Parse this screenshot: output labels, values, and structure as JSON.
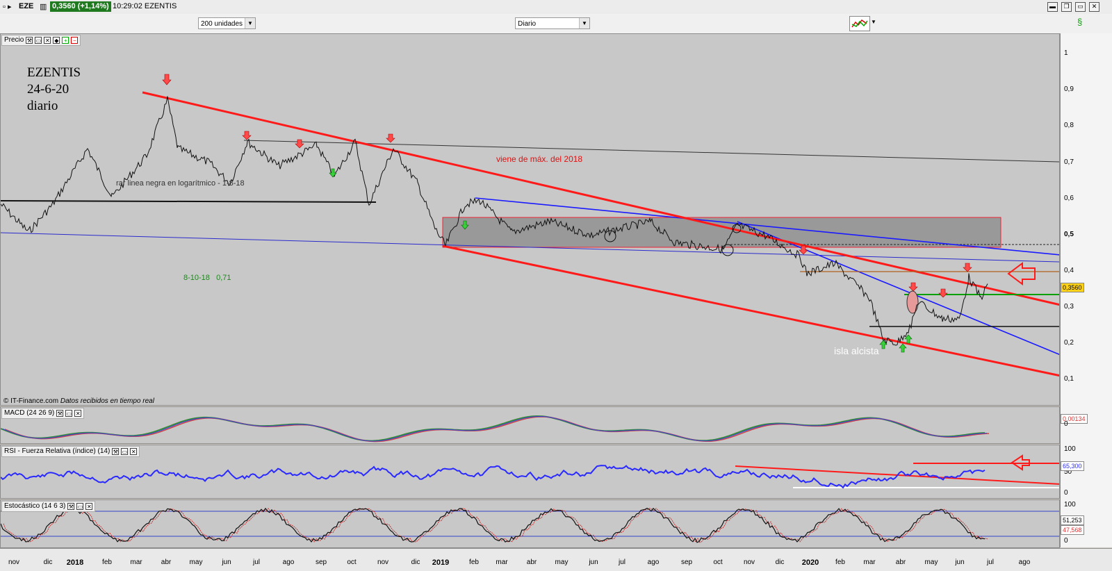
{
  "titlebar": {
    "symbol": "EZE",
    "price_badge": "0,3560 (+1,14%)",
    "time_name": "10:29:02 EZENTIS"
  },
  "toolbar": {
    "units_select": "200 unidades",
    "period_select": "Diario"
  },
  "price_panel": {
    "label": "Precio",
    "title_lines": [
      "EZENTIS",
      "24-6-20",
      "diario"
    ],
    "annotation_max_2018": "viene de máx. del 2018",
    "annotation_log": "rar linea negra en logarítmico - 1-8-18",
    "annotation_date": "8-10-18   0,71",
    "annotation_island": "isla alcista",
    "footer_source": "© IT-Finance.com",
    "footer_note": "Datos recibidos en tiempo real",
    "y_ticks": [
      "1",
      "0,9",
      "0,8",
      "0,7",
      "0,6",
      "0,5",
      "0,4",
      "0,3",
      "0,2",
      "0,1"
    ],
    "last_price": "0,3560"
  },
  "macd_panel": {
    "label": "MACD (24 26 9)",
    "value_badge": "0,00134",
    "y_tick": "0"
  },
  "rsi_panel": {
    "label": "RSI - Fuerza Relativa (índice) (14)",
    "y_ticks": [
      "100",
      "50",
      "0"
    ],
    "value_badge": "65,300"
  },
  "stoch_panel": {
    "label": "Estocástico (14 6 3)",
    "y_ticks": [
      "100",
      "0"
    ],
    "value_badge_1": "51,253",
    "value_badge_2": "47,568"
  },
  "x_axis": [
    {
      "label": "nov",
      "year": false
    },
    {
      "label": "dic",
      "year": false
    },
    {
      "label": "2018",
      "year": true
    },
    {
      "label": "feb",
      "year": false
    },
    {
      "label": "mar",
      "year": false
    },
    {
      "label": "abr",
      "year": false
    },
    {
      "label": "may",
      "year": false
    },
    {
      "label": "jun",
      "year": false
    },
    {
      "label": "jul",
      "year": false
    },
    {
      "label": "ago",
      "year": false
    },
    {
      "label": "sep",
      "year": false
    },
    {
      "label": "oct",
      "year": false
    },
    {
      "label": "nov",
      "year": false
    },
    {
      "label": "dic",
      "year": false
    },
    {
      "label": "2019",
      "year": true
    },
    {
      "label": "feb",
      "year": false
    },
    {
      "label": "mar",
      "year": false
    },
    {
      "label": "abr",
      "year": false
    },
    {
      "label": "may",
      "year": false
    },
    {
      "label": "jun",
      "year": false
    },
    {
      "label": "jul",
      "year": false
    },
    {
      "label": "ago",
      "year": false
    },
    {
      "label": "sep",
      "year": false
    },
    {
      "label": "oct",
      "year": false
    },
    {
      "label": "nov",
      "year": false
    },
    {
      "label": "dic",
      "year": false
    },
    {
      "label": "2020",
      "year": true
    },
    {
      "label": "feb",
      "year": false
    },
    {
      "label": "mar",
      "year": false
    },
    {
      "label": "abr",
      "year": false
    },
    {
      "label": "may",
      "year": false
    },
    {
      "label": "jun",
      "year": false
    },
    {
      "label": "jul",
      "year": false
    },
    {
      "label": "ago",
      "year": false
    }
  ],
  "colors": {
    "trend_red": "#ff1a1a",
    "trend_blue": "#1a1aff",
    "support_green": "#00a000",
    "box_gray": "#8a8a8a",
    "rsi_line": "#2a2aff",
    "accent_badge": "#1f7a1f"
  }
}
